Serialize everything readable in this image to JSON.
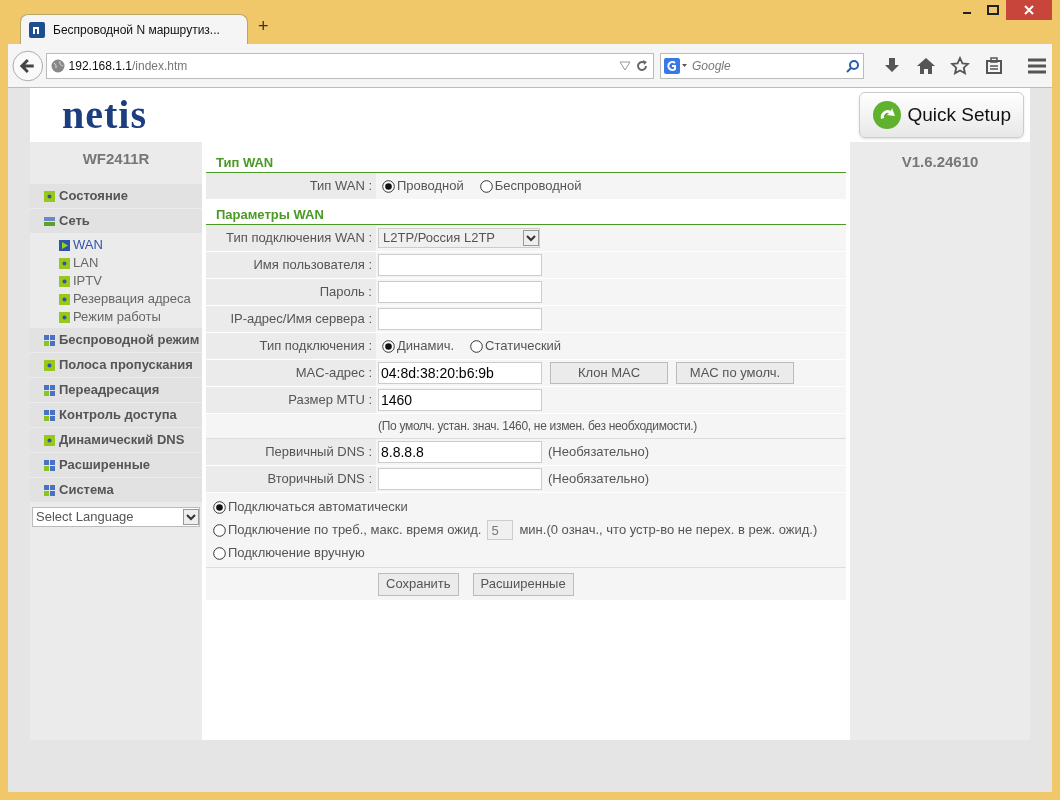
{
  "browser": {
    "tab_title": "Беспроводной N маршрутиз...",
    "new_tab": "+",
    "url_host": "192.168.1.1",
    "url_path": "/index.htm",
    "search_placeholder": "Google"
  },
  "header": {
    "logo": "netis",
    "quick_setup": "Quick Setup"
  },
  "model": "WF2411R",
  "version": "V1.6.24610",
  "sidebar": {
    "items": [
      {
        "label": "Состояние",
        "kind": "page"
      },
      {
        "label": "Сеть",
        "kind": "group",
        "expanded": true,
        "children": [
          {
            "label": "WAN",
            "selected": true
          },
          {
            "label": "LAN",
            "selected": false
          },
          {
            "label": "IPTV",
            "selected": false
          },
          {
            "label": "Резервация адреса",
            "selected": false
          },
          {
            "label": "Режим работы",
            "selected": false
          }
        ]
      },
      {
        "label": "Беспроводной режим",
        "kind": "group",
        "expanded": false
      },
      {
        "label": "Полоса пропускания",
        "kind": "page"
      },
      {
        "label": "Переадресация",
        "kind": "group",
        "expanded": false
      },
      {
        "label": "Контроль доступа",
        "kind": "group",
        "expanded": false
      },
      {
        "label": "Динамический DNS",
        "kind": "page"
      },
      {
        "label": "Расширенные",
        "kind": "group",
        "expanded": false
      },
      {
        "label": "Система",
        "kind": "group",
        "expanded": false
      }
    ],
    "language_select": "Select Language"
  },
  "sections": [
    {
      "title": "Тип WAN",
      "rows": [
        {
          "kind": "radio",
          "label": "Тип WAN :",
          "options": [
            {
              "label": "Проводной",
              "selected": true
            },
            {
              "label": "Беспроводной",
              "selected": false
            }
          ]
        }
      ]
    },
    {
      "title": "Параметры WAN",
      "rows": [
        {
          "kind": "select",
          "label": "Тип подключения WAN :",
          "value": "L2TP/Россия L2TP"
        },
        {
          "kind": "input",
          "label": "Имя пользователя :"
        },
        {
          "kind": "input",
          "label": "Пароль :"
        },
        {
          "kind": "input",
          "label": "IP-адрес/Имя сервера :"
        },
        {
          "kind": "radio",
          "label": "Тип подключения :",
          "options": [
            {
              "label": "Динамич.",
              "selected": true
            },
            {
              "label": "Статический",
              "selected": false
            }
          ]
        },
        {
          "kind": "input",
          "label": "MAC-адрес :",
          "value": "04:8d:38:20:b6:9b",
          "buttons": [
            "Клон MAC",
            "MAC по умолч."
          ]
        },
        {
          "kind": "input",
          "label": "Размер MTU :",
          "value": "1460"
        },
        {
          "kind": "note",
          "text": "(По умолч. устан. знач. 1460, не измен. без необходимости.)"
        },
        {
          "kind": "input",
          "label": "Первичный DNS :",
          "value": "8.8.8.8",
          "hint": "(Необязательно)"
        },
        {
          "kind": "input",
          "label": "Вторичный DNS :",
          "hint": "(Необязательно)"
        }
      ]
    }
  ],
  "connect_modes": [
    {
      "label": "Подключаться автоматически",
      "selected": true
    },
    {
      "label": "Подключение по треб., макс. время ожид.",
      "selected": false,
      "idle_value": "5",
      "suffix": "мин.(0 означ., что устр-во не перех. в реж. ожид.)"
    },
    {
      "label": "Подключение вручную",
      "selected": false
    }
  ],
  "buttons": [
    "Сохранить",
    "Расширенные"
  ]
}
